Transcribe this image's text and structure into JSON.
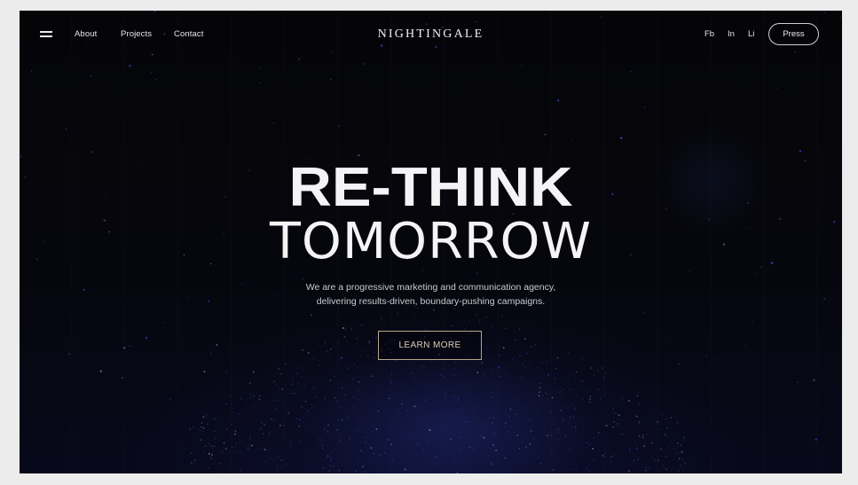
{
  "nav": {
    "links": [
      "About",
      "Projects",
      "Contact"
    ],
    "brand": "NIGHTINGALE",
    "social": [
      "Fb",
      "In",
      "Li"
    ],
    "press_label": "Press",
    "menu_icon": "hamburger-menu-icon"
  },
  "hero": {
    "headline_1": "RE-THINK",
    "headline_2": "TOMORROW",
    "subtitle_line_1": "We are a progressive marketing and communication agency,",
    "subtitle_line_2": "delivering results-driven, boundary-pushing campaigns.",
    "cta_label": "LEARN MORE"
  },
  "colors": {
    "background": "#030306",
    "text": "#f4f4f6",
    "cta_border": "#b9a68a",
    "accent_blue": "#2a3a9c"
  }
}
